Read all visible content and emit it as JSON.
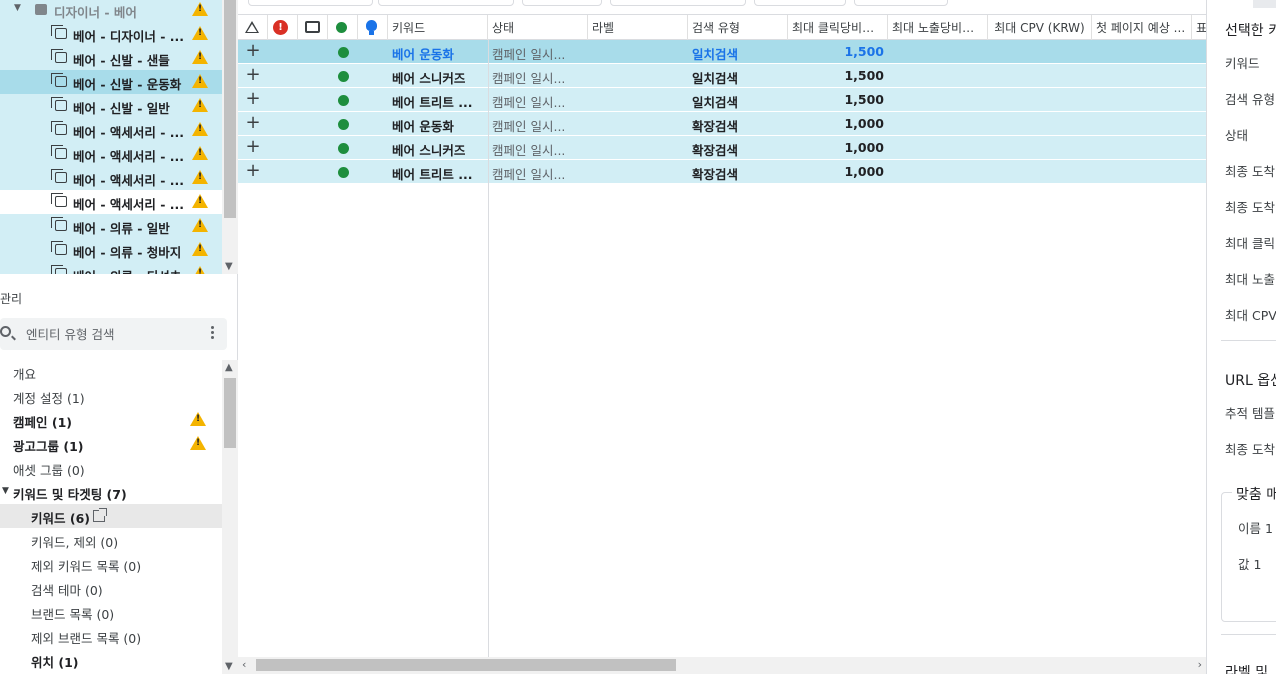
{
  "tree": {
    "items": [
      {
        "label": "디자이너 - 베어",
        "kind": "campaign",
        "warn": true
      },
      {
        "label": "베어 - 디자이너 - ...",
        "kind": "adgroup",
        "warn": true
      },
      {
        "label": "베어 - 신발 - 샌들",
        "kind": "adgroup",
        "warn": true
      },
      {
        "label": "베어 - 신발 - 운동화",
        "kind": "adgroup",
        "warn": true
      },
      {
        "label": "베어 - 신발 - 일반",
        "kind": "adgroup",
        "warn": true
      },
      {
        "label": "베어 - 액세서리 - ...",
        "kind": "adgroup",
        "warn": true
      },
      {
        "label": "베어 - 액세서리 - ...",
        "kind": "adgroup",
        "warn": true
      },
      {
        "label": "베어 - 액세서리 - ...",
        "kind": "adgroup",
        "warn": true
      },
      {
        "label": "베어 - 액세서리 - ...",
        "kind": "adgroup",
        "warn": true
      },
      {
        "label": "베어 - 의류 - 일반",
        "kind": "adgroup",
        "warn": true
      },
      {
        "label": "베어 - 의류 - 청바지",
        "kind": "adgroup",
        "warn": true
      },
      {
        "label": "베어 - 의류 - 티셔츠",
        "kind": "adgroup",
        "warn": true
      }
    ]
  },
  "management": {
    "title": "관리",
    "search_placeholder": "엔티티 유형 검색",
    "items": [
      {
        "label": "개요"
      },
      {
        "label": "계정 설정 (1)"
      },
      {
        "label": "캠페인 (1)",
        "bold": true,
        "warn": true
      },
      {
        "label": "광고그룹 (1)",
        "bold": true,
        "warn": true
      },
      {
        "label": "애셋 그룹 (0)"
      },
      {
        "label": "키워드 및 타겟팅 (7)",
        "bold": true
      },
      {
        "label": "키워드 (6)",
        "bold": true
      },
      {
        "label": "키워드, 제외 (0)"
      },
      {
        "label": "제외 키워드 목록 (0)"
      },
      {
        "label": "검색 테마 (0)"
      },
      {
        "label": "브랜드 목록 (0)"
      },
      {
        "label": "제외 브랜드 목록 (0)"
      },
      {
        "label": "위치 (1)",
        "bold": true
      }
    ]
  },
  "grid": {
    "headers": {
      "keyword": "키워드",
      "status": "상태",
      "label": "라벨",
      "match_type": "검색 유형",
      "max_cpc": "최대 클릭당비용...",
      "max_cpm": "최대 노출당비용...",
      "max_cpv": "최대 CPV (KRW)",
      "first_page": "첫 페이지 예상 ...",
      "extra": "표"
    },
    "rows": [
      {
        "keyword": "베어 운동화",
        "status": "캠페인 일시...",
        "label": "",
        "match_type": "일치검색",
        "max_cpc": "1,500",
        "selected": true
      },
      {
        "keyword": "베어 스니커즈",
        "status": "캠페인 일시...",
        "label": "",
        "match_type": "일치검색",
        "max_cpc": "1,500"
      },
      {
        "keyword": "베어 트리트 ...",
        "status": "캠페인 일시...",
        "label": "",
        "match_type": "일치검색",
        "max_cpc": "1,500"
      },
      {
        "keyword": "베어 운동화",
        "status": "캠페인 일시...",
        "label": "",
        "match_type": "확장검색",
        "max_cpc": "1,000"
      },
      {
        "keyword": "베어 스니커즈",
        "status": "캠페인 일시...",
        "label": "",
        "match_type": "확장검색",
        "max_cpc": "1,000"
      },
      {
        "keyword": "베어 트리트 ...",
        "status": "캠페인 일시...",
        "label": "",
        "match_type": "확장검색",
        "max_cpc": "1,000"
      }
    ]
  },
  "edit_panel": {
    "title": "선택한 키",
    "fields": [
      "키워드",
      "검색 유형",
      "상태",
      "최종 도착",
      "최종 도착",
      "최대 클릭",
      "최대 노출",
      "최대 CPV"
    ],
    "url_section": "URL 옵션",
    "url_fields": [
      "추적 템플",
      "최종 도착"
    ],
    "custom_legend": "맞춤 매",
    "custom_fields": [
      "이름 1",
      "값 1"
    ],
    "labels_section": "라벨 및"
  },
  "colors": {
    "row_bg": "#d2eef5",
    "row_selected_bg": "#a8dcea",
    "link_blue": "#1a73e8",
    "status_green": "#1e8e3e",
    "warning_yellow": "#f4b400",
    "error_red": "#d93025"
  }
}
